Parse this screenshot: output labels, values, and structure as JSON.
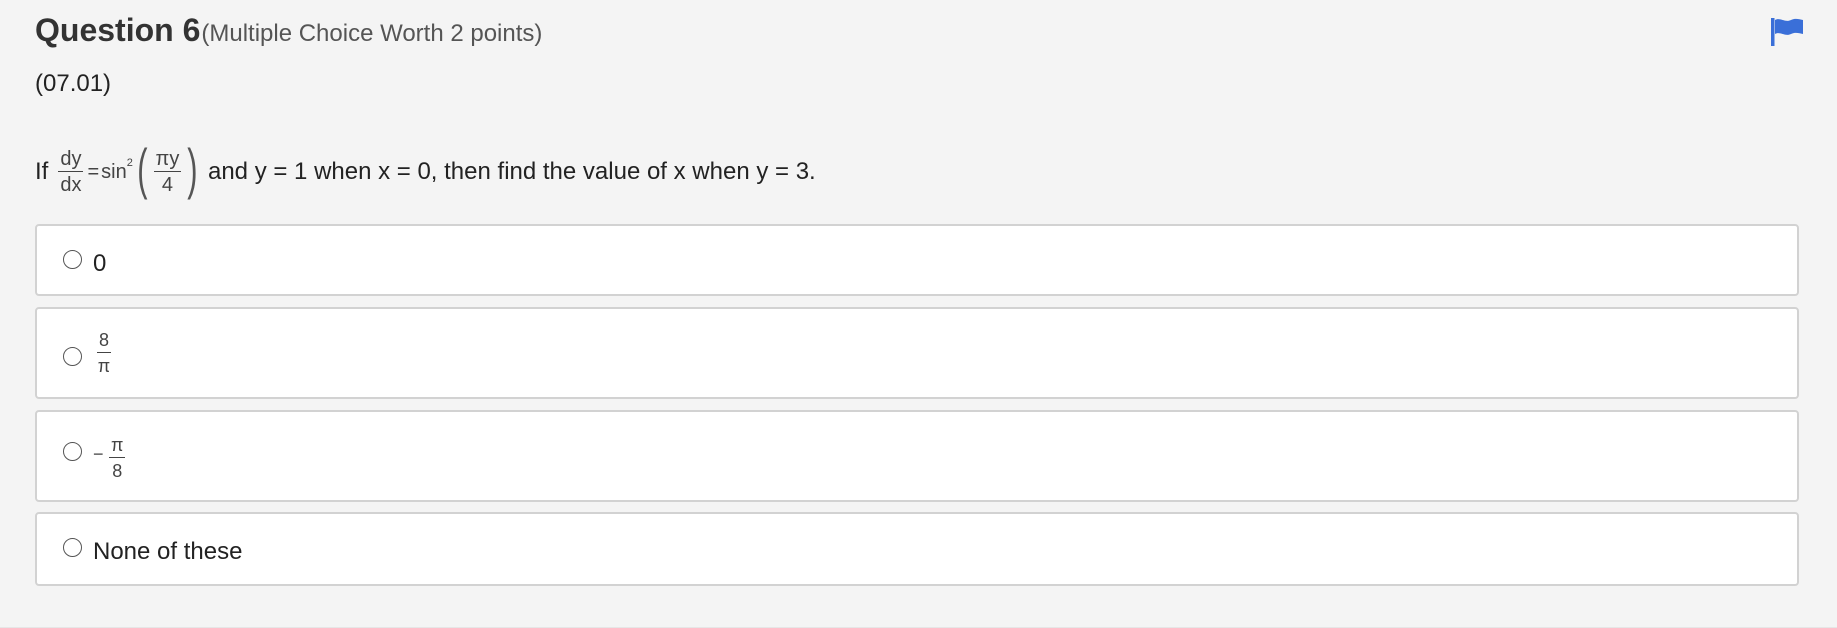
{
  "question": {
    "title": "Question 6",
    "subtitle": "(Multiple Choice Worth 2 points)",
    "code": "(07.01)",
    "prompt_prefix": "If",
    "math": {
      "dy": "dy",
      "dx": "dx",
      "equals": "=",
      "sin": "sin",
      "squared": "2",
      "pi_y": "πy",
      "four": "4"
    },
    "prompt_suffix": "and y = 1 when x = 0, then find the value of x when y = 3."
  },
  "choices": [
    {
      "label": "0"
    },
    {
      "numerator": "8",
      "denominator": "π"
    },
    {
      "sign": "−",
      "numerator": "π",
      "denominator": "8"
    },
    {
      "label": "None of these"
    }
  ],
  "colors": {
    "flag": "#3a6fd8",
    "background": "#f4f4f4",
    "card_border": "#d2d2d2"
  },
  "icons": {
    "flag": "flag-icon",
    "radio": "radio-button"
  }
}
